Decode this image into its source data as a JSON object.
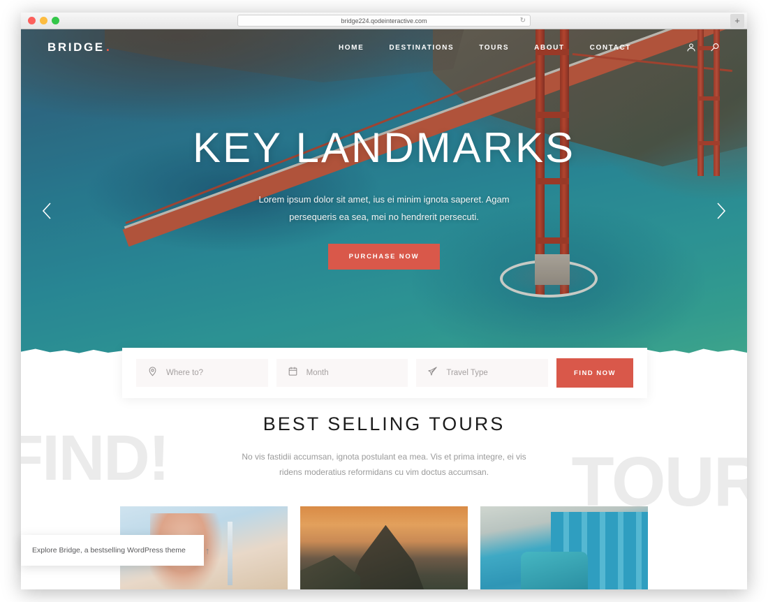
{
  "browser": {
    "url": "bridge224.qodeinteractive.com",
    "reload_icon": "reload-icon",
    "new_tab_label": "+",
    "traffic_lights": [
      "close",
      "minimize",
      "maximize"
    ]
  },
  "nav": {
    "logo_text": "BRIDGE",
    "logo_dot": ".",
    "items": [
      {
        "label": "HOME"
      },
      {
        "label": "DESTINATIONS"
      },
      {
        "label": "TOURS"
      },
      {
        "label": "ABOUT"
      },
      {
        "label": "CONTACT"
      }
    ],
    "icons": [
      {
        "name": "user-icon"
      },
      {
        "name": "search-icon"
      }
    ]
  },
  "hero": {
    "title": "KEY LANDMARKS",
    "subtitle": "Lorem ipsum dolor sit amet, ius ei minim ignota saperet. Agam persequeris ea sea, mei no hendrerit persecuti.",
    "button_label": "PURCHASE NOW",
    "prev_arrow": "‹",
    "next_arrow": "›",
    "accent_color": "#d9584a"
  },
  "search_panel": {
    "fields": [
      {
        "icon": "map-pin-icon",
        "placeholder": "Where to?"
      },
      {
        "icon": "calendar-icon",
        "placeholder": "Month"
      },
      {
        "icon": "plane-icon",
        "placeholder": "Travel Type"
      }
    ],
    "button_label": "FIND NOW"
  },
  "tours": {
    "title": "BEST SELLING TOURS",
    "subtitle": "No vis fastidii accumsan, ignota postulant ea mea. Vis et prima integre, ei vis ridens moderatius reformidans cu vim doctus accumsan.",
    "watermark_left": "FIND!",
    "watermark_right": "TOUR",
    "cards": [
      {
        "alt": "woman-smiling-barcelona"
      },
      {
        "alt": "mountain-sunset"
      },
      {
        "alt": "cuban-street-classic-car"
      }
    ]
  },
  "notice": {
    "text": "Explore Bridge, a bestselling WordPress theme",
    "arrow": "↑"
  }
}
